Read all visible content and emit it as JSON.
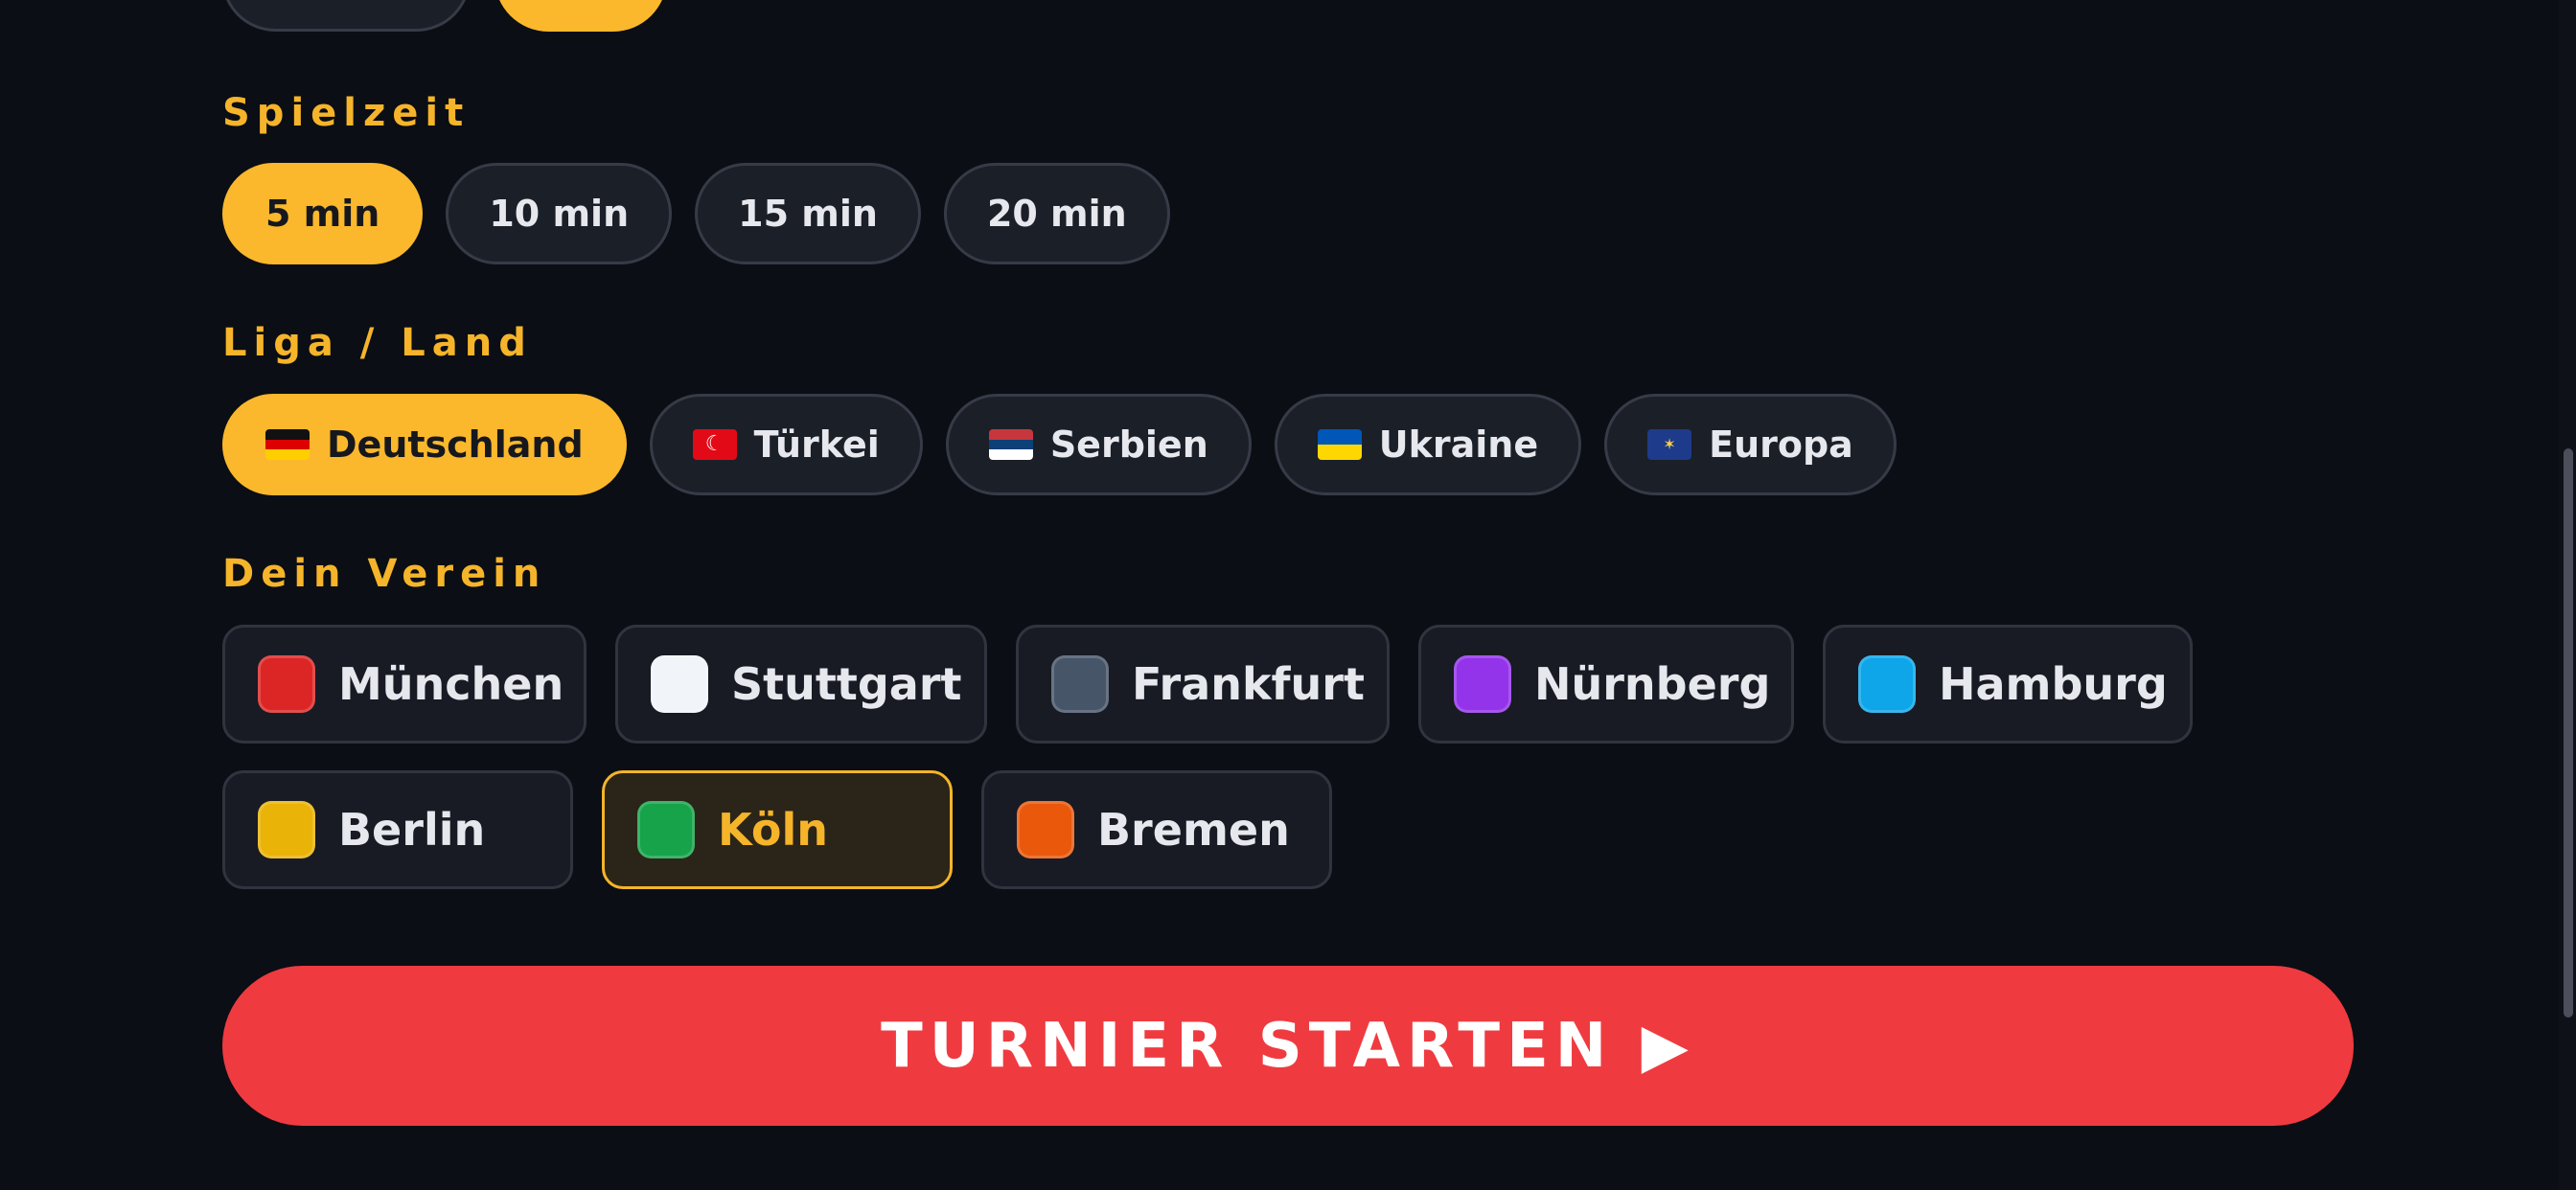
{
  "spielzeit": {
    "label": "Spielzeit",
    "options": [
      "5 min",
      "10 min",
      "15 min",
      "20 min"
    ],
    "selected": "5 min"
  },
  "liga": {
    "label": "Liga / Land",
    "options": [
      {
        "name": "Deutschland",
        "flag": "de-flag-icon"
      },
      {
        "name": "Türkei",
        "flag": "tr-flag-icon"
      },
      {
        "name": "Serbien",
        "flag": "rs-flag-icon"
      },
      {
        "name": "Ukraine",
        "flag": "ua-flag-icon"
      },
      {
        "name": "Europa",
        "flag": "eu-flag-icon"
      }
    ],
    "selected": "Deutschland"
  },
  "verein": {
    "label": "Dein Verein",
    "clubs": [
      {
        "name": "München",
        "color": "#dc2626"
      },
      {
        "name": "Stuttgart",
        "color": "#f1f5f9"
      },
      {
        "name": "Frankfurt",
        "color": "#475569"
      },
      {
        "name": "Nürnberg",
        "color": "#9333ea"
      },
      {
        "name": "Hamburg",
        "color": "#0ea5e9"
      },
      {
        "name": "Berlin",
        "color": "#eab308"
      },
      {
        "name": "Köln",
        "color": "#16a34a"
      },
      {
        "name": "Bremen",
        "color": "#ea580c"
      }
    ],
    "selected": "Köln"
  },
  "start_button": {
    "label": "TURNIER STARTEN ▶"
  },
  "theme": {
    "accent": "#fbb82c",
    "start": "#ef3b40",
    "background": "#0b0e14"
  }
}
